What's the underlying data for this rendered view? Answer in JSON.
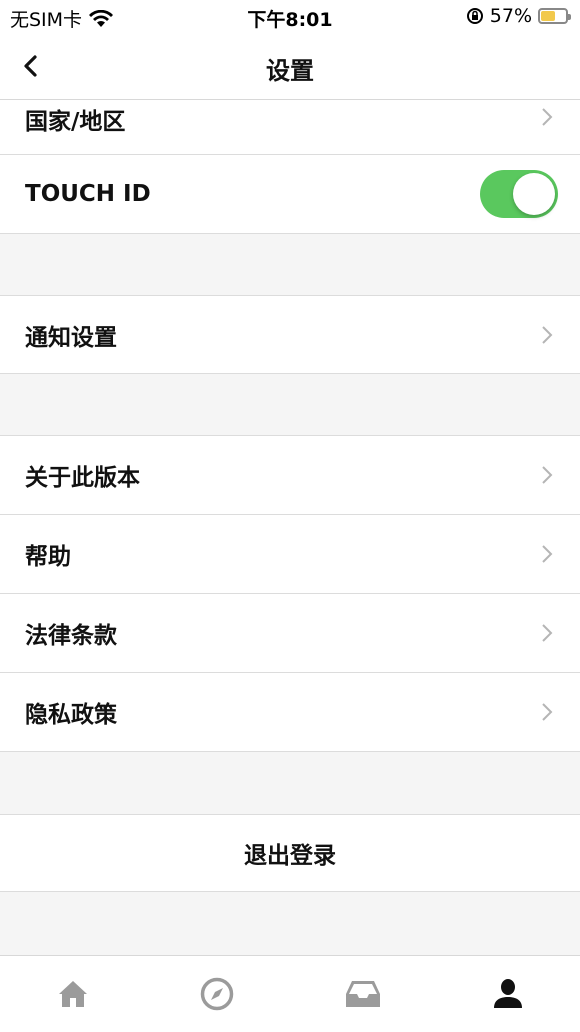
{
  "status_bar": {
    "carrier": "无SIM卡",
    "time": "下午8:01",
    "battery": "57%",
    "battery_level": 0.57,
    "battery_color": "#f2c94c"
  },
  "nav": {
    "title": "设置"
  },
  "rows": {
    "country": "国家/地区",
    "touch_id": "TOUCH ID",
    "touch_id_enabled": true,
    "notifications": "通知设置",
    "about": "关于此版本",
    "help": "帮助",
    "legal": "法律条款",
    "privacy": "隐私政策",
    "logout": "退出登录"
  },
  "tabs": [
    {
      "icon": "home-icon",
      "active": false
    },
    {
      "icon": "compass-icon",
      "active": false
    },
    {
      "icon": "inbox-icon",
      "active": false
    },
    {
      "icon": "profile-icon",
      "active": true
    }
  ],
  "colors": {
    "toggle_on": "#5ac85e",
    "tab_inactive": "#9b9b9b",
    "tab_active": "#111111"
  }
}
